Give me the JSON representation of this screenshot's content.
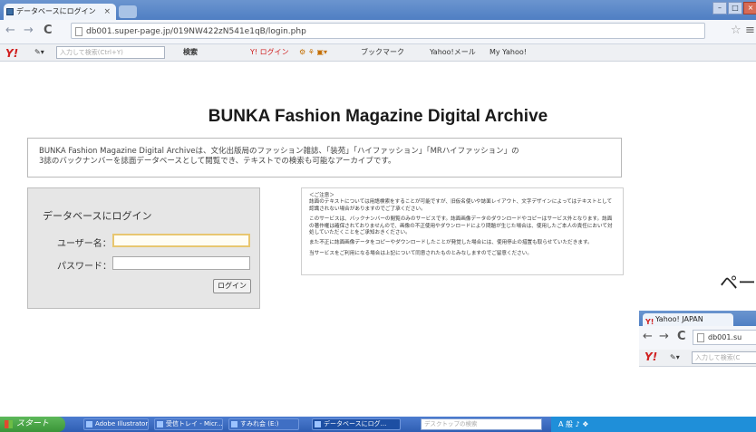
{
  "browser": {
    "tab_title": "データベースにログイン",
    "tab_close": "×",
    "url": "db001.super-page.jp/019NW422zN541e1qB/login.php",
    "window_buttons": [
      "–",
      "□",
      "×"
    ]
  },
  "nav": {
    "back": "←",
    "forward": "→",
    "reload": "C",
    "star": "☆",
    "menu": "≡"
  },
  "yahoo_toolbar": {
    "logo": "Y!",
    "search_placeholder": "入力して検索(Ctrl+Y)",
    "search_button": "検索",
    "login": "Y! ログイン",
    "bookmarks": "ブックマーク",
    "mail": "Yahoo!メール",
    "my_yahoo": "My Yahoo!"
  },
  "page": {
    "title": "BUNKA Fashion Magazine Digital Archive",
    "description_line1": "BUNKA Fashion Magazine Digital Archiveは、文化出版局のファッション雑誌、「装苑」「ハイファッション」「MRハイファッション」の",
    "description_line2": "3誌のバックナンバーを誌面データベースとして閲覧でき、テキストでの検索も可能なアーカイブです。",
    "login": {
      "heading": "データベースにログイン",
      "username_label": "ユーザー名：",
      "password_label": "パスワード：",
      "username_value": "",
      "password_value": "",
      "button": "ログイン"
    },
    "notice": {
      "heading": "＜ご注意＞",
      "p1": "誌面のテキストについては用語検索をすることが可能ですが、旧仮名使いや誌面レイアウト、文字デザインによってはテキストとして認識されない場合がありますのでご了承ください。",
      "p2": "このサービスは、バックナンバーの閲覧のみのサービスです。誌面画像データのダウンロードやコピーはサービス外となります。誌面の著作権は確保されておりませんので、画像の不正使用やダウンロードにより問題が生じた場合は、使用したご本人の責任において対処していただくことをご承知おきください。",
      "p3": "また不正に誌面画像データをコピーやダウンロードしたことが発覚した場合には、使用停止の措置も取らせていただきます。",
      "p4": "当サービスをご利用になる場合は上記について同意されたものとみなしますのでご留意ください。"
    },
    "side_text": "ペー"
  },
  "second_window": {
    "tab_title": "Yahoo! JAPAN",
    "url": "db001.su",
    "search_placeholder": "入力して検索(C"
  },
  "taskbar": {
    "start": "スタート",
    "tasks": [
      "Adobe Illustrator...",
      "受信トレイ - Micr...",
      "すみれ会 (E:)",
      "データベースにログ..."
    ],
    "search_placeholder": "デスクトップの検索",
    "tray": "A 般 ♪ ❖"
  }
}
